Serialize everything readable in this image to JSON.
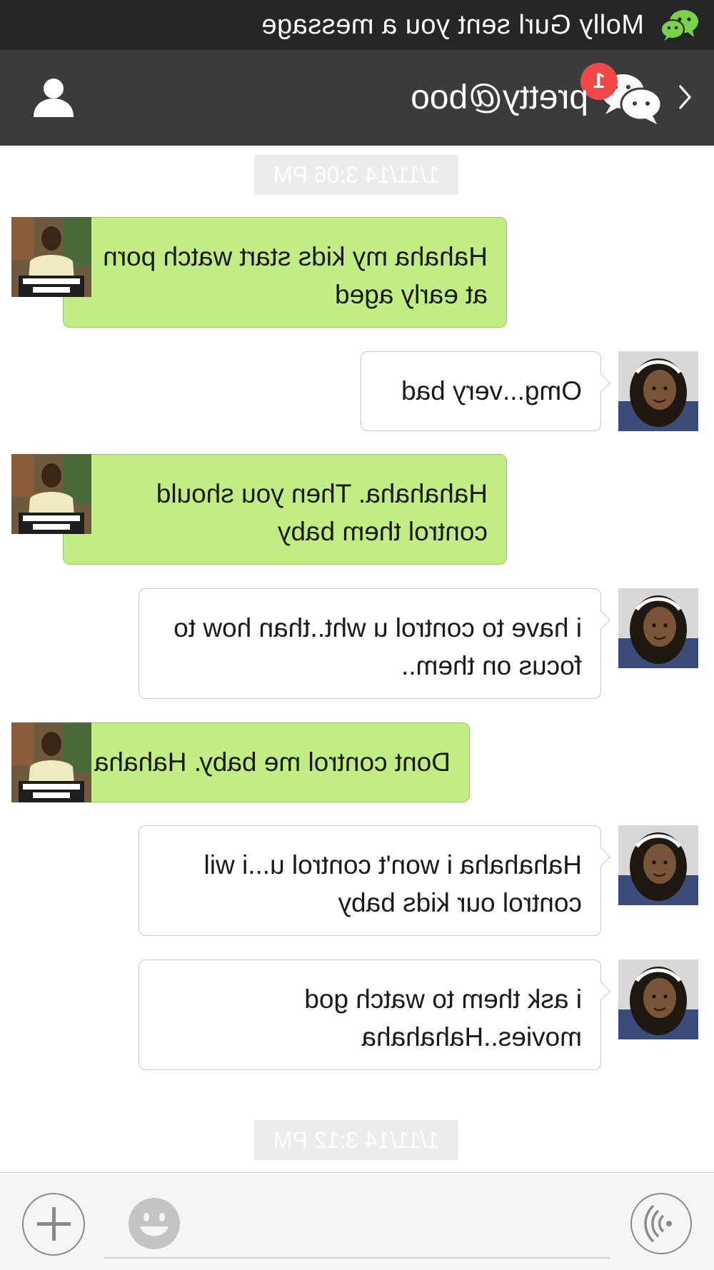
{
  "notification": {
    "text": "Molly Gurl sent you a message",
    "icon": "wechat-icon"
  },
  "header": {
    "title": "pretty@boo",
    "unread_badge": "1",
    "back_icon": "chevron-left-icon",
    "chats_icon": "chat-bubbles-icon",
    "profile_icon": "user-profile-icon"
  },
  "timestamps": [
    "1/11/14 3:06 PM",
    "1/11/14 3:12 PM"
  ],
  "messages": [
    {
      "side": "right",
      "text": "Hahaha my kids start watch porn at early aged"
    },
    {
      "side": "left",
      "text": "Omg...very bad"
    },
    {
      "side": "right",
      "text": "Hahahaha. Then you should control them baby"
    },
    {
      "side": "left",
      "text": "i have to control u wht..than how to focus on them.."
    },
    {
      "side": "right",
      "text": "Dont control me baby. Hahaha"
    },
    {
      "side": "left",
      "text": "Hahahaha i won't control u...i wil control our kids baby"
    },
    {
      "side": "left",
      "text": "i ask them to watch god movies..Hahahaha"
    }
  ],
  "input_bar": {
    "voice_icon": "voice-wave-icon",
    "emoji_icon": "smiley-icon",
    "plus_icon": "plus-icon",
    "placeholder": ""
  },
  "colors": {
    "notification_bg": "#242627",
    "header_bg": "#393b3d",
    "sent_bubble": "#c2ec84",
    "received_bubble": "#ffffff",
    "badge": "#f04848",
    "wechat_green": "#7bd14a"
  }
}
